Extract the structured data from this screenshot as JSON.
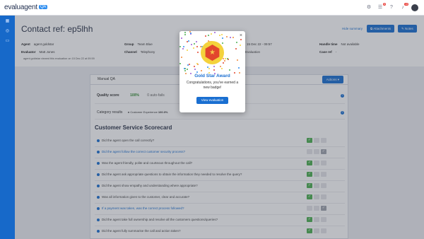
{
  "app": {
    "logo_text": "evaluagent",
    "logo_badge": "QA"
  },
  "topbar": {
    "icons": [
      {
        "name": "settings-icon",
        "badge": ""
      },
      {
        "name": "tasks-icon",
        "badge": "5"
      },
      {
        "name": "help-icon",
        "badge": ""
      },
      {
        "name": "notifications-icon",
        "badge": "13"
      }
    ]
  },
  "header": {
    "title": "Contact ref: ep5lhh",
    "hide_summary": "Hide summary",
    "attachments_label": "Attachments",
    "notes_label": "Notes",
    "agent_label": "Agent",
    "agent_value": "agent goldstar",
    "evaluator_label": "Evaluator",
    "evaluator_value": "Matt Jones",
    "group_label": "Group",
    "group_value": "Team Blue",
    "channel_label": "Channel",
    "channel_value": "Telephony",
    "date_value": "15 Dec 22 - 09:57",
    "evaluation_value": "Evaluation",
    "handle_time_label": "Handle time",
    "handle_time_value": "Not available",
    "case_ref_label": "Case ref",
    "case_ref_value": "-",
    "viewed_note": "agent goldstar viewed this evaluation on 15 Dec 22 at 09:59"
  },
  "panel": {
    "tab": "Manual QA",
    "actions_label": "Actions",
    "quality_score_label": "Quality score",
    "quality_score_value": "100%",
    "quality_extra": "0 auto-fails",
    "category_results_label": "Category results",
    "category_item": "Customer Experience",
    "category_item_score": "100.0%",
    "scorecard_title": "Customer Service Scorecard",
    "questions": [
      {
        "text": "Did the agent open the call correctly?",
        "blue": false,
        "state": "yes"
      },
      {
        "text": "Did the agent follow the correct customer security process?",
        "blue": true,
        "state": "na"
      },
      {
        "text": "Was the agent friendly, polite and courteous throughout the call?",
        "blue": false,
        "state": "yes"
      },
      {
        "text": "Did the agent ask appropriate questions to obtain the information they needed to resolve the query?",
        "blue": false,
        "state": "yes"
      },
      {
        "text": "Did the agent show empathy and understanding where appropriate?",
        "blue": false,
        "state": "yes"
      },
      {
        "text": "Was all information given to the customer, clear and accurate?",
        "blue": false,
        "state": "yes"
      },
      {
        "text": "If a payment was taken, was the correct process followed?",
        "blue": true,
        "state": "na"
      },
      {
        "text": "Did the agent take full ownership and resolve all the customers questions/queries?",
        "blue": false,
        "state": "yes"
      },
      {
        "text": "Did the agent fully summarise the call and action taken?",
        "blue": false,
        "state": "yes"
      }
    ]
  },
  "modal": {
    "title": "Gold Star Award",
    "message": "Congratulations, you've earned a new badge!",
    "button": "View evaluation"
  },
  "colors": {
    "primary": "#1a6fd1",
    "success": "#4caf50",
    "sidebar": "#1769c9",
    "medal_gold": "#f4d23c",
    "medal_red": "#e2452d"
  }
}
